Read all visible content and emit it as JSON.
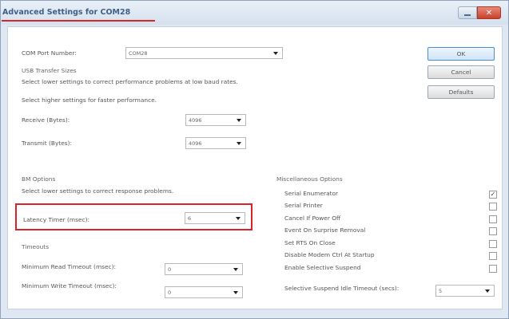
{
  "window": {
    "title": "Advanced Settings for COM28"
  },
  "buttons": {
    "ok": "OK",
    "cancel": "Cancel",
    "defaults": "Defaults"
  },
  "com_port": {
    "label": "COM Port Number:",
    "value": "COM28"
  },
  "usb": {
    "header": "USB Transfer Sizes",
    "line1": "Select lower settings to correct performance problems at low baud rates.",
    "line2": "Select higher settings for faster performance.",
    "receive_label": "Receive (Bytes):",
    "receive_value": "4096",
    "transmit_label": "Transmit (Bytes):",
    "transmit_value": "4096"
  },
  "bm": {
    "header": "BM Options",
    "line1": "Select lower settings to correct response problems.",
    "latency_label": "Latency Timer (msec):",
    "latency_value": "6"
  },
  "timeouts": {
    "header": "Timeouts",
    "read_label": "Minimum Read Timeout (msec):",
    "read_value": "0",
    "write_label": "Minimum Write Timeout (msec):",
    "write_value": "0"
  },
  "misc": {
    "header": "Miscellaneous Options",
    "options": [
      {
        "label": "Serial Enumerator",
        "checked": true,
        "mark": "✓"
      },
      {
        "label": "Serial Printer",
        "checked": false,
        "mark": ""
      },
      {
        "label": "Cancel If Power Off",
        "checked": false,
        "mark": ""
      },
      {
        "label": "Event On Surprise Removal",
        "checked": false,
        "mark": ""
      },
      {
        "label": "Set RTS On Close",
        "checked": false,
        "mark": ""
      },
      {
        "label": "Disable Modem Ctrl At Startup",
        "checked": false,
        "mark": ""
      },
      {
        "label": "Enable Selective Suspend",
        "checked": false,
        "mark": ""
      }
    ],
    "suspend_label": "Selective Suspend Idle Timeout (secs):",
    "suspend_value": "5"
  },
  "colors": {
    "highlight": "#d9222a",
    "title_underline": "#d12a2a",
    "title_text": "#3f5f86"
  },
  "icons": {
    "minimize": "minimize-icon",
    "close": "close-icon",
    "dropdown": "chevron-down-icon",
    "check": "checkmark-icon"
  }
}
